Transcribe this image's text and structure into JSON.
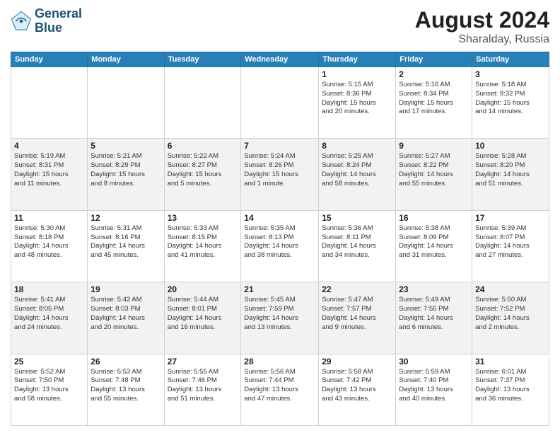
{
  "logo": {
    "line1": "General",
    "line2": "Blue"
  },
  "title": "August 2024",
  "location": "Sharalday, Russia",
  "days_header": [
    "Sunday",
    "Monday",
    "Tuesday",
    "Wednesday",
    "Thursday",
    "Friday",
    "Saturday"
  ],
  "weeks": [
    [
      {
        "day": "",
        "info": ""
      },
      {
        "day": "",
        "info": ""
      },
      {
        "day": "",
        "info": ""
      },
      {
        "day": "",
        "info": ""
      },
      {
        "day": "1",
        "info": "Sunrise: 5:15 AM\nSunset: 8:36 PM\nDaylight: 15 hours\nand 20 minutes."
      },
      {
        "day": "2",
        "info": "Sunrise: 5:16 AM\nSunset: 8:34 PM\nDaylight: 15 hours\nand 17 minutes."
      },
      {
        "day": "3",
        "info": "Sunrise: 5:18 AM\nSunset: 8:32 PM\nDaylight: 15 hours\nand 14 minutes."
      }
    ],
    [
      {
        "day": "4",
        "info": "Sunrise: 5:19 AM\nSunset: 8:31 PM\nDaylight: 15 hours\nand 11 minutes."
      },
      {
        "day": "5",
        "info": "Sunrise: 5:21 AM\nSunset: 8:29 PM\nDaylight: 15 hours\nand 8 minutes."
      },
      {
        "day": "6",
        "info": "Sunrise: 5:22 AM\nSunset: 8:27 PM\nDaylight: 15 hours\nand 5 minutes."
      },
      {
        "day": "7",
        "info": "Sunrise: 5:24 AM\nSunset: 8:26 PM\nDaylight: 15 hours\nand 1 minute."
      },
      {
        "day": "8",
        "info": "Sunrise: 5:25 AM\nSunset: 8:24 PM\nDaylight: 14 hours\nand 58 minutes."
      },
      {
        "day": "9",
        "info": "Sunrise: 5:27 AM\nSunset: 8:22 PM\nDaylight: 14 hours\nand 55 minutes."
      },
      {
        "day": "10",
        "info": "Sunrise: 5:28 AM\nSunset: 8:20 PM\nDaylight: 14 hours\nand 51 minutes."
      }
    ],
    [
      {
        "day": "11",
        "info": "Sunrise: 5:30 AM\nSunset: 8:18 PM\nDaylight: 14 hours\nand 48 minutes."
      },
      {
        "day": "12",
        "info": "Sunrise: 5:31 AM\nSunset: 8:16 PM\nDaylight: 14 hours\nand 45 minutes."
      },
      {
        "day": "13",
        "info": "Sunrise: 5:33 AM\nSunset: 8:15 PM\nDaylight: 14 hours\nand 41 minutes."
      },
      {
        "day": "14",
        "info": "Sunrise: 5:35 AM\nSunset: 8:13 PM\nDaylight: 14 hours\nand 38 minutes."
      },
      {
        "day": "15",
        "info": "Sunrise: 5:36 AM\nSunset: 8:11 PM\nDaylight: 14 hours\nand 34 minutes."
      },
      {
        "day": "16",
        "info": "Sunrise: 5:38 AM\nSunset: 8:09 PM\nDaylight: 14 hours\nand 31 minutes."
      },
      {
        "day": "17",
        "info": "Sunrise: 5:39 AM\nSunset: 8:07 PM\nDaylight: 14 hours\nand 27 minutes."
      }
    ],
    [
      {
        "day": "18",
        "info": "Sunrise: 5:41 AM\nSunset: 8:05 PM\nDaylight: 14 hours\nand 24 minutes."
      },
      {
        "day": "19",
        "info": "Sunrise: 5:42 AM\nSunset: 8:03 PM\nDaylight: 14 hours\nand 20 minutes."
      },
      {
        "day": "20",
        "info": "Sunrise: 5:44 AM\nSunset: 8:01 PM\nDaylight: 14 hours\nand 16 minutes."
      },
      {
        "day": "21",
        "info": "Sunrise: 5:45 AM\nSunset: 7:59 PM\nDaylight: 14 hours\nand 13 minutes."
      },
      {
        "day": "22",
        "info": "Sunrise: 5:47 AM\nSunset: 7:57 PM\nDaylight: 14 hours\nand 9 minutes."
      },
      {
        "day": "23",
        "info": "Sunrise: 5:49 AM\nSunset: 7:55 PM\nDaylight: 14 hours\nand 6 minutes."
      },
      {
        "day": "24",
        "info": "Sunrise: 5:50 AM\nSunset: 7:52 PM\nDaylight: 14 hours\nand 2 minutes."
      }
    ],
    [
      {
        "day": "25",
        "info": "Sunrise: 5:52 AM\nSunset: 7:50 PM\nDaylight: 13 hours\nand 58 minutes."
      },
      {
        "day": "26",
        "info": "Sunrise: 5:53 AM\nSunset: 7:48 PM\nDaylight: 13 hours\nand 55 minutes."
      },
      {
        "day": "27",
        "info": "Sunrise: 5:55 AM\nSunset: 7:46 PM\nDaylight: 13 hours\nand 51 minutes."
      },
      {
        "day": "28",
        "info": "Sunrise: 5:56 AM\nSunset: 7:44 PM\nDaylight: 13 hours\nand 47 minutes."
      },
      {
        "day": "29",
        "info": "Sunrise: 5:58 AM\nSunset: 7:42 PM\nDaylight: 13 hours\nand 43 minutes."
      },
      {
        "day": "30",
        "info": "Sunrise: 5:59 AM\nSunset: 7:40 PM\nDaylight: 13 hours\nand 40 minutes."
      },
      {
        "day": "31",
        "info": "Sunrise: 6:01 AM\nSunset: 7:37 PM\nDaylight: 13 hours\nand 36 minutes."
      }
    ]
  ]
}
